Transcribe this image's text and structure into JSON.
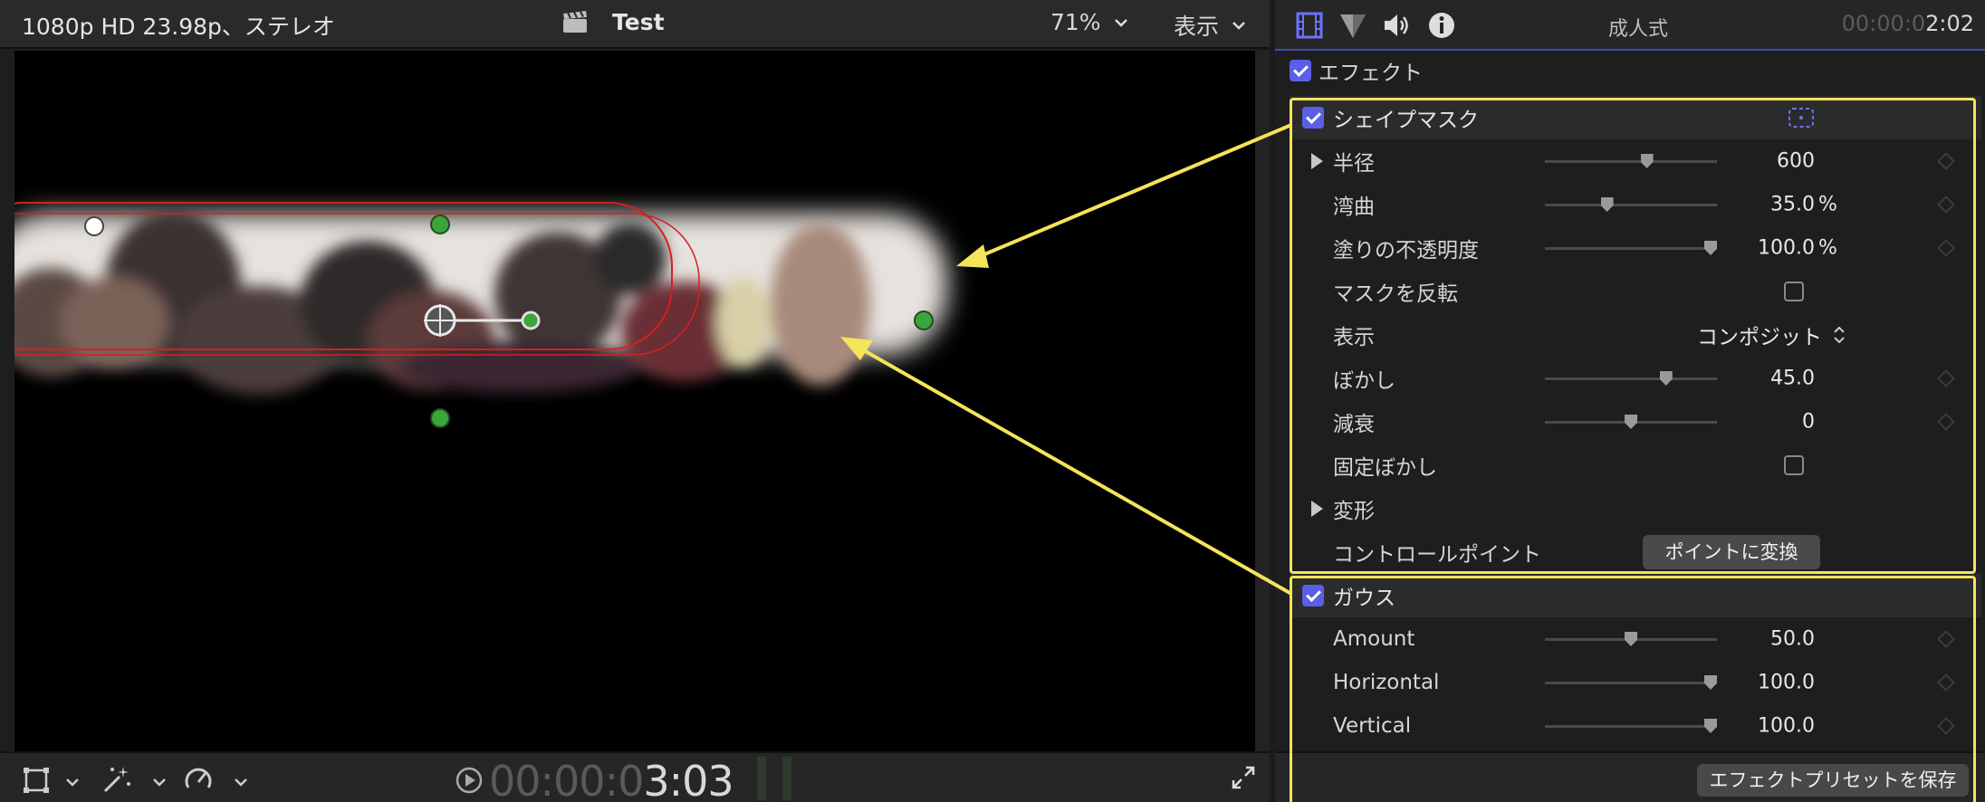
{
  "viewer": {
    "format": "1080p HD 23.98p、ステレオ",
    "project": "Test",
    "zoom": "71%",
    "view_menu": "表示",
    "timecode_dim": "00:00:0",
    "timecode_lit": "3:03"
  },
  "inspector": {
    "clip_name": "成人式",
    "duration_dim": "00:00:0",
    "duration_lit": "2:02",
    "effects_label": "エフェクト",
    "shape_mask": {
      "title": "シェイプマスク",
      "params": [
        {
          "label": "半径",
          "value": "600",
          "unit": "",
          "level": 0.6
        },
        {
          "label": "湾曲",
          "value": "35.0",
          "unit": "%",
          "level": 0.35
        },
        {
          "label": "塗りの不透明度",
          "value": "100.0",
          "unit": "%",
          "level": 1.0
        }
      ],
      "invert_label": "マスクを反転",
      "display_label": "表示",
      "display_value": "コンポジット",
      "blur": {
        "label": "ぼかし",
        "value": "45.0",
        "level": 0.72
      },
      "falloff": {
        "label": "減衰",
        "value": "0",
        "level": 0.5
      },
      "fixed_blur_label": "固定ぼかし",
      "transform_label": "変形",
      "control_points_label": "コントロールポイント",
      "convert_button": "ポイントに変換"
    },
    "gaussian": {
      "title": "ガウス",
      "params": [
        {
          "label": "Amount",
          "value": "50.0",
          "level": 0.5
        },
        {
          "label": "Horizontal",
          "value": "100.0",
          "level": 1.0
        },
        {
          "label": "Vertical",
          "value": "100.0",
          "level": 1.0
        }
      ]
    },
    "save_preset_button": "エフェクトプリセットを保存"
  },
  "colors": {
    "accent": "#5b5ee6",
    "annotation": "#f5e35a",
    "mask_outline": "#d42020",
    "handle": "#3aa53a"
  },
  "icons": [
    "clapper-icon",
    "chevron-down-icon",
    "film-icon",
    "color-icon",
    "speaker-icon",
    "info-icon",
    "transform-icon",
    "magic-wand-icon",
    "speed-icon",
    "play-icon",
    "fullscreen-icon"
  ]
}
